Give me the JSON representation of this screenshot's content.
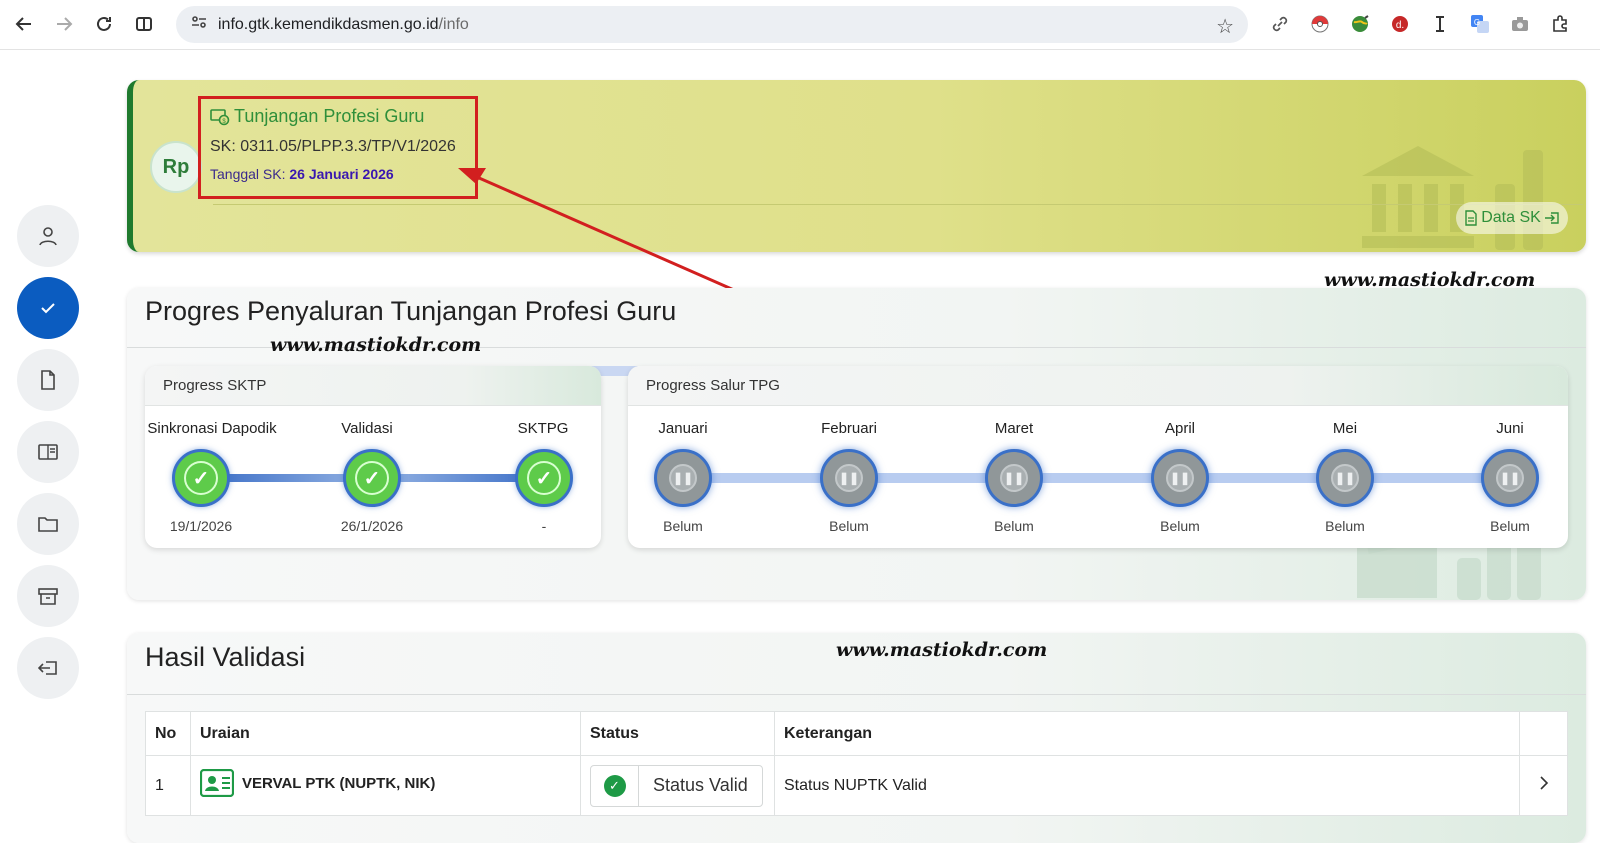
{
  "browser": {
    "url_host": "info.gtk.kemendikdasmen.go.id",
    "url_path": "/info"
  },
  "banner": {
    "icon": "Rp",
    "title": "Tunjangan Profesi Guru",
    "sk": "SK: 0311.05/PLPP.3.3/TP/V1/2026",
    "date_label": "Tanggal SK:",
    "date_value": "26 Januari 2026",
    "button_label": "Data SK"
  },
  "watermarks": [
    "www.mastiokdr.com",
    "www.mastiokdr.com",
    "www.mastiokdr.com"
  ],
  "progress": {
    "title": "Progres Penyaluran Tunjangan Profesi Guru",
    "sktp": {
      "title": "Progress SKTP",
      "steps": [
        {
          "label": "Sinkronasi Dapodik",
          "date": "19/1/2026"
        },
        {
          "label": "Validasi",
          "date": "26/1/2026"
        },
        {
          "label": "SKTPG",
          "date": "-"
        }
      ]
    },
    "salur": {
      "title": "Progress Salur TPG",
      "months": [
        {
          "label": "Januari",
          "status": "Belum"
        },
        {
          "label": "Februari",
          "status": "Belum"
        },
        {
          "label": "Maret",
          "status": "Belum"
        },
        {
          "label": "April",
          "status": "Belum"
        },
        {
          "label": "Mei",
          "status": "Belum"
        },
        {
          "label": "Juni",
          "status": "Belum"
        }
      ]
    }
  },
  "validasi": {
    "title": "Hasil Validasi",
    "headers": [
      "No",
      "Uraian",
      "Status",
      "Keterangan"
    ],
    "rows": [
      {
        "no": "1",
        "uraian": "VERVAL PTK (NUPTK, NIK)",
        "status": "Status Valid",
        "keterangan": "Status NUPTK Valid"
      }
    ]
  },
  "colors": {
    "accent_blue": "#0b5cc0",
    "success_green": "#1e9a46",
    "brand_green": "#2f8f3a",
    "highlight_red": "#d21f1f"
  }
}
